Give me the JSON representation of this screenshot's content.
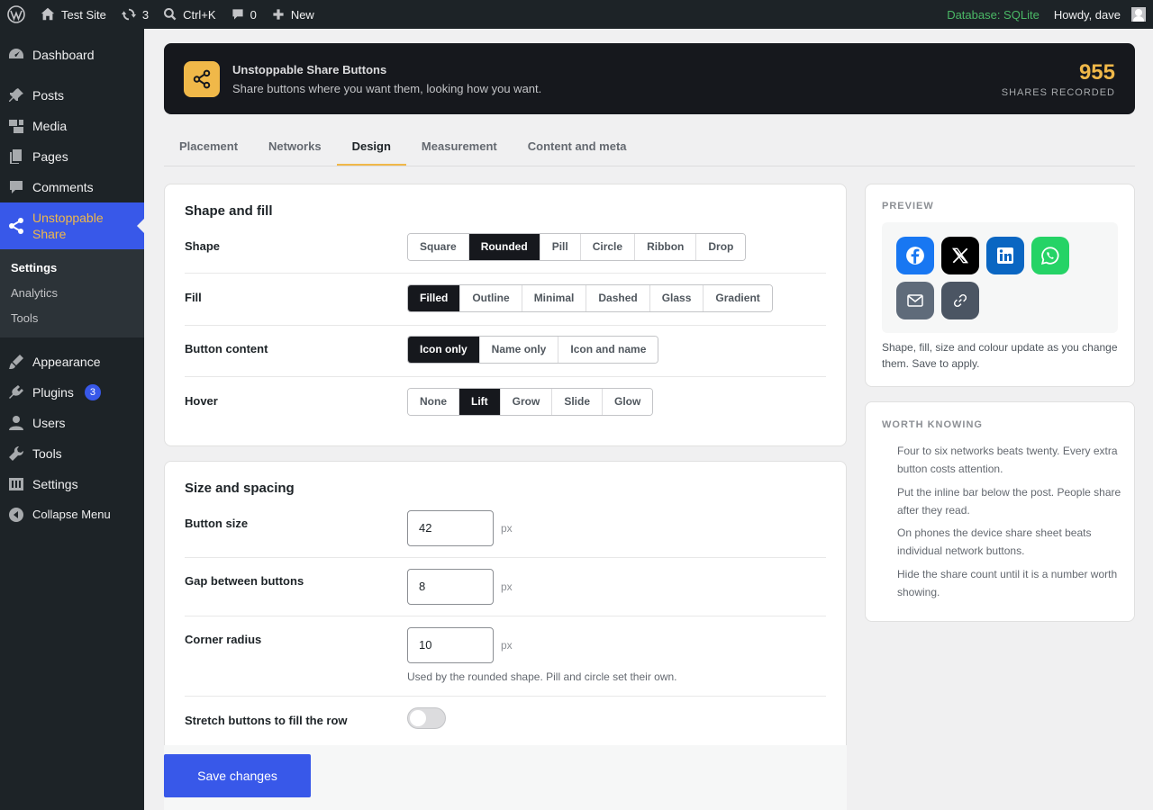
{
  "adminbar": {
    "site_name": "Test Site",
    "updates_count": "3",
    "search_shortcut": "Ctrl+K",
    "comments_count": "0",
    "new_label": "New",
    "database_label": "Database: SQLite",
    "greeting": "Howdy, dave"
  },
  "sidebar": {
    "items": [
      {
        "label": "Dashboard",
        "icon": "dashboard-icon"
      },
      {
        "label": "Posts",
        "icon": "pin-icon"
      },
      {
        "label": "Media",
        "icon": "media-icon"
      },
      {
        "label": "Pages",
        "icon": "pages-icon"
      },
      {
        "label": "Comments",
        "icon": "comment-icon"
      },
      {
        "label": "Unstoppable Share",
        "icon": "share-icon"
      },
      {
        "label": "Appearance",
        "icon": "brush-icon"
      },
      {
        "label": "Plugins",
        "icon": "plugin-icon",
        "badge": "3"
      },
      {
        "label": "Users",
        "icon": "user-icon"
      },
      {
        "label": "Tools",
        "icon": "wrench-icon"
      },
      {
        "label": "Settings",
        "icon": "sliders-icon"
      },
      {
        "label": "Collapse Menu",
        "icon": "collapse-icon"
      }
    ],
    "submenu": [
      "Settings",
      "Analytics",
      "Tools"
    ]
  },
  "banner": {
    "title": "Unstoppable Share Buttons",
    "subtitle": "Share buttons where you want them, looking how you want.",
    "stat_value": "955",
    "stat_label": "SHARES RECORDED"
  },
  "tabs": [
    "Placement",
    "Networks",
    "Design",
    "Measurement",
    "Content and meta"
  ],
  "active_tab": "Design",
  "shape_fill": {
    "heading": "Shape and fill",
    "shape": {
      "label": "Shape",
      "options": [
        "Square",
        "Rounded",
        "Pill",
        "Circle",
        "Ribbon",
        "Drop"
      ],
      "selected": "Rounded"
    },
    "fill": {
      "label": "Fill",
      "options": [
        "Filled",
        "Outline",
        "Minimal",
        "Dashed",
        "Glass",
        "Gradient"
      ],
      "selected": "Filled"
    },
    "content": {
      "label": "Button content",
      "options": [
        "Icon only",
        "Name only",
        "Icon and name"
      ],
      "selected": "Icon only"
    },
    "hover": {
      "label": "Hover",
      "options": [
        "None",
        "Lift",
        "Grow",
        "Slide",
        "Glow"
      ],
      "selected": "Lift"
    }
  },
  "size_spacing": {
    "heading": "Size and spacing",
    "button_size": {
      "label": "Button size",
      "value": "42",
      "unit": "px"
    },
    "gap": {
      "label": "Gap between buttons",
      "value": "8",
      "unit": "px"
    },
    "radius": {
      "label": "Corner radius",
      "value": "10",
      "unit": "px",
      "help": "Used by the rounded shape. Pill and circle set their own."
    },
    "stretch": {
      "label": "Stretch buttons to fill the row",
      "on": false
    }
  },
  "save_label": "Save changes",
  "preview": {
    "heading": "PREVIEW",
    "note": "Shape, fill, size and colour update as you change them. Save to apply.",
    "buttons": [
      {
        "icon": "facebook-icon",
        "color": "#1877f2"
      },
      {
        "icon": "x-icon",
        "color": "#000000"
      },
      {
        "icon": "linkedin-icon",
        "color": "#0a66c2"
      },
      {
        "icon": "whatsapp-icon",
        "color": "#25d366"
      },
      {
        "icon": "email-icon",
        "color": "#5f6b7a"
      },
      {
        "icon": "link-icon",
        "color": "#4b5563"
      }
    ]
  },
  "worth_knowing": {
    "heading": "WORTH KNOWING",
    "tips": [
      "Four to six networks beats twenty. Every extra button costs attention.",
      "Put the inline bar below the post. People share after they read.",
      "On phones the device share sheet beats individual network buttons.",
      "Hide the share count until it is a number worth showing."
    ]
  },
  "colors": {
    "accent": "#3858e9",
    "highlight": "#f0b849",
    "dark": "#16181d"
  }
}
